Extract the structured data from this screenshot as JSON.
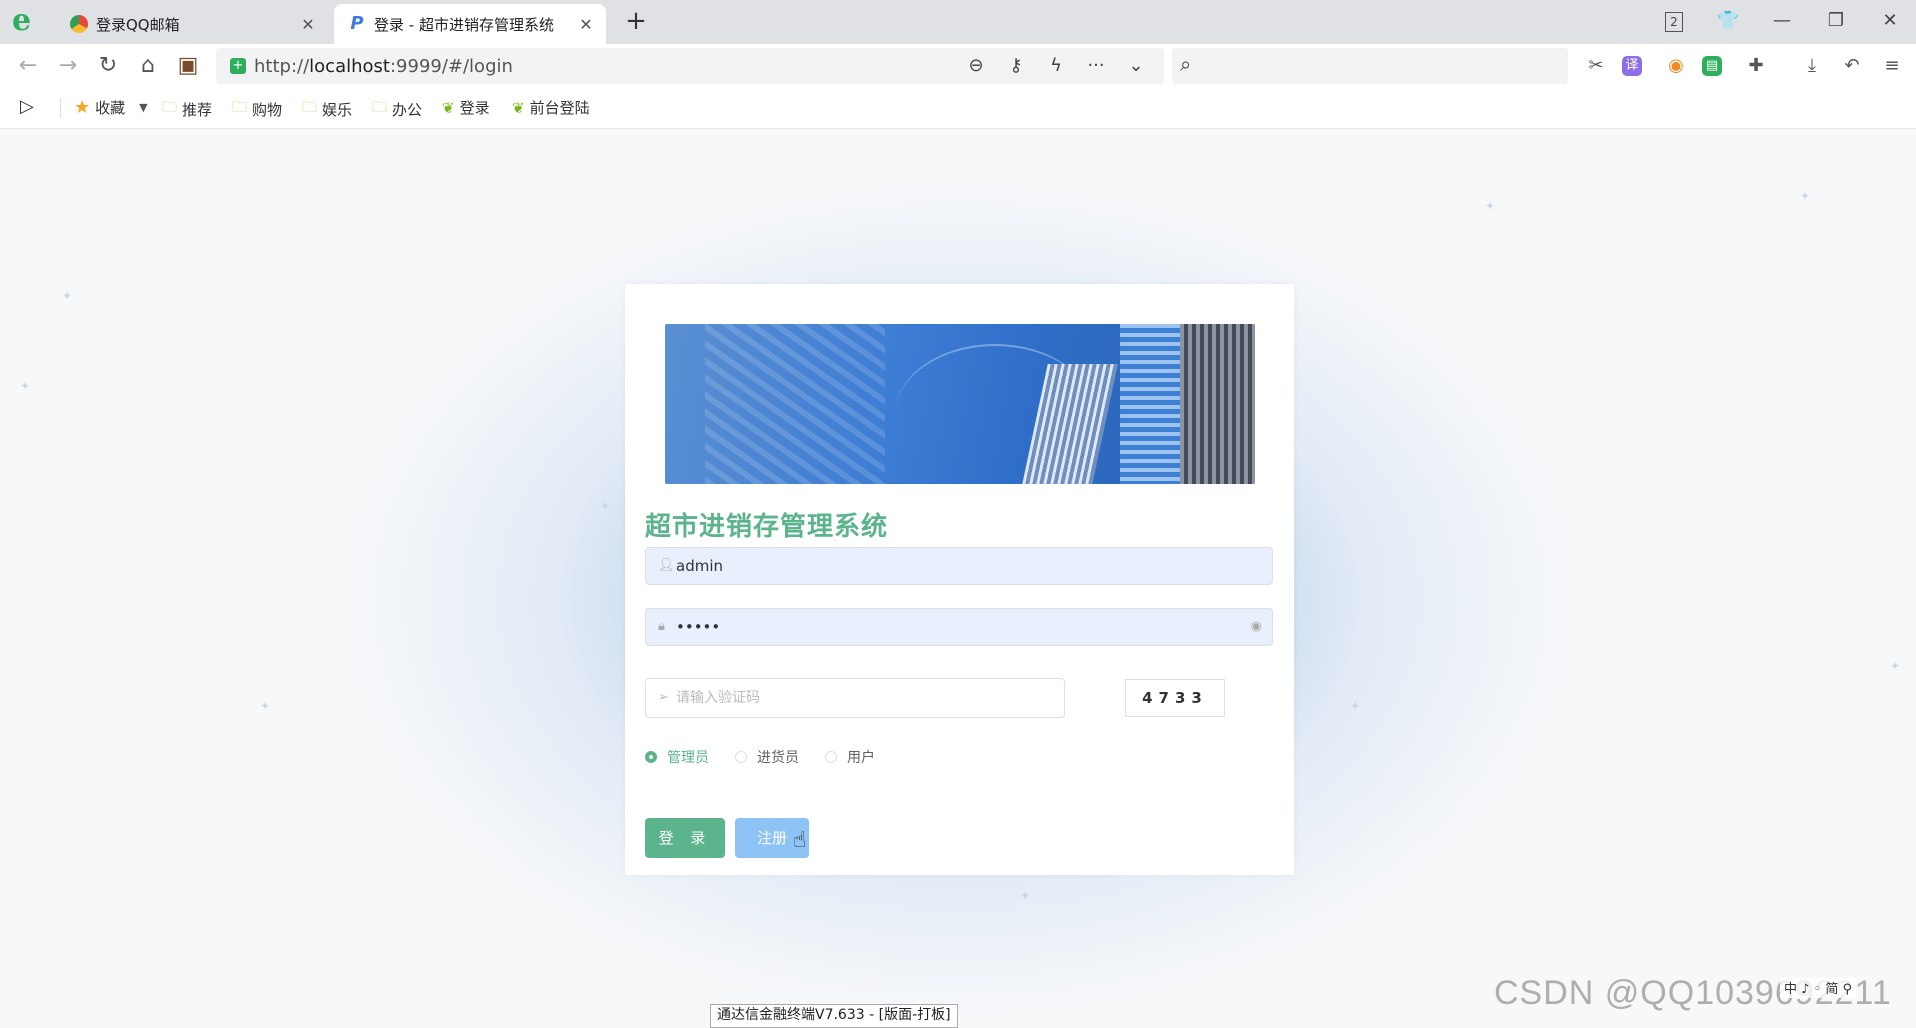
{
  "browser": {
    "tabs": [
      {
        "title": "登录QQ邮箱",
        "icon": "qq-mail-icon",
        "active": false
      },
      {
        "title": "登录 - 超市进销存管理系统",
        "icon": "page-p-icon",
        "active": true
      }
    ],
    "new_tab_symbol": "+",
    "tab_count_badge": "2",
    "url_prefix": "http://",
    "url_host": "localhost",
    "url_rest": ":9999/#/login",
    "bookmarks": [
      "收藏",
      "推荐",
      "购物",
      "娱乐",
      "办公",
      "登录",
      "前台登陆"
    ]
  },
  "login": {
    "system_title": "超市进销存管理系统",
    "username_value": "admin",
    "password_value": "•••••",
    "captcha_placeholder": "请输入验证码",
    "captcha_code": "4733",
    "roles": [
      {
        "label": "管理员",
        "checked": true
      },
      {
        "label": "进货员",
        "checked": false
      },
      {
        "label": "用户",
        "checked": false
      }
    ],
    "login_button": "登 录",
    "register_button": "注册"
  },
  "overlays": {
    "taskbar_tooltip": "通达信金融终端V7.633 - [版面-打板]",
    "ime_status": "中 ♪ ◦ 简 ⚲",
    "watermark": "CSDN @QQ1039692211"
  },
  "colors": {
    "accent": "#5bb48c",
    "register": "#8dc3f5",
    "input_fill": "#e8f0fe"
  }
}
